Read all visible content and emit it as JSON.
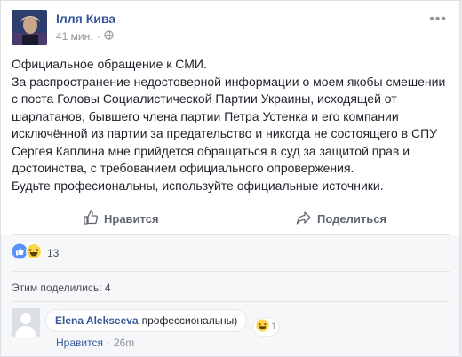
{
  "post": {
    "author": "Ілля Кива",
    "time": "41 мин.",
    "text_lines": [
      "Официальное обращение к СМИ.",
      "За распространение недостоверной информации о моем якобы смешении",
      "с поста Головы Социалистической Партии Украины, исходящей от",
      "шарлатанов, бывшего члена партии Петра Устенка и его компании",
      "исключённой из партии за предательство и никогда не состоящего в СПУ",
      "Сергея Каплина мне прийдется обращаться в суд за защитой прав и",
      "достоинства, с требованием официального опровержения.",
      "Будьте професиональны, используйте официальные источники."
    ]
  },
  "actions": {
    "like": "Нравится",
    "share": "Поделиться"
  },
  "reactions": {
    "count": "13"
  },
  "shared_text": "Этим поделились: 4",
  "comment": {
    "author": "Elena Alekseeva",
    "text": "профессиональны)",
    "reaction_count": "1",
    "like_label": "Нравится",
    "separator": "·",
    "time": "26m"
  },
  "colors": {
    "link": "#365899",
    "like_blue": "#5890ff",
    "haha_yellow": "#fcd34d"
  },
  "icons": [
    "more-options-icon",
    "globe-icon",
    "thumbs-up-icon",
    "share-arrow-icon",
    "like-reaction-icon",
    "haha-reaction-icon"
  ]
}
